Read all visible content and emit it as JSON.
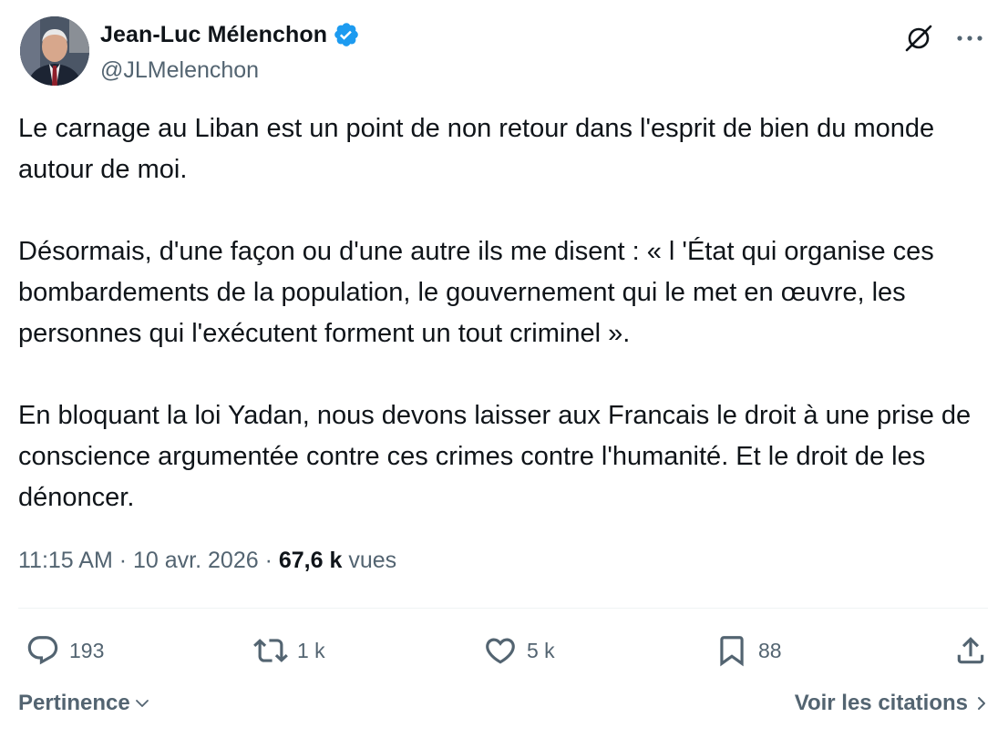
{
  "author": {
    "display_name": "Jean-Luc Mélenchon",
    "handle": "@JLMelenchon",
    "verified": true,
    "verified_color": "#1d9bf0"
  },
  "header_icons": [
    "grok-icon",
    "more-options-icon"
  ],
  "tweet": {
    "paragraphs": [
      "Le carnage au Liban est un point de non retour dans l'esprit de bien du monde autour de moi.",
      "Désormais, d'une façon ou d'une autre ils me disent : « l 'État qui organise ces bombardements de la population, le gouvernement qui le met en œuvre, les personnes qui l'exécutent forment un tout criminel ».",
      "En bloquant la loi Yadan, nous devons laisser aux Francais le droit à une prise de conscience argumentée contre ces crimes contre l'humanité. Et le droit de les dénoncer."
    ]
  },
  "meta": {
    "time": "11:15 AM",
    "separator": "·",
    "date": "10 avr. 2026",
    "views_count": "67,6 k",
    "views_label": "vues"
  },
  "actions": {
    "replies": "193",
    "reposts": "1 k",
    "likes": "5 k",
    "bookmarks": "88"
  },
  "footer": {
    "sort_label": "Pertinence",
    "quotes_label": "Voir les citations"
  },
  "colors": {
    "text": "#0f1419",
    "secondary": "#536471",
    "divider": "#eff3f4",
    "accent": "#1d9bf0"
  }
}
